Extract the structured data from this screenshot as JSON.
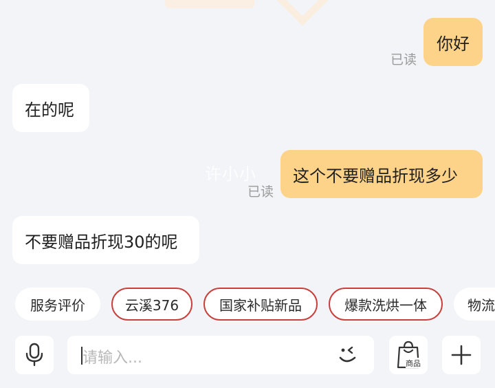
{
  "messages": [
    {
      "from": "me",
      "text": "你好",
      "status": "已读"
    },
    {
      "from": "them",
      "text": "在的呢"
    },
    {
      "from": "me",
      "text": "这个不要赠品折现多少",
      "status": "已读"
    },
    {
      "from": "them",
      "text": "不要赠品折现30的呢"
    }
  ],
  "watermark": "许小小",
  "quick_replies": [
    "服务评价",
    "云溪376",
    "国家补贴新品",
    "爆款洗烘一体",
    "物流"
  ],
  "input": {
    "placeholder": "请输入..."
  },
  "product_button_label": "商品",
  "colors": {
    "my_bubble": "#fdd38a",
    "their_bubble": "#ffffff",
    "background": "#f3f4f8",
    "chip_highlight_border": "#c8403c"
  }
}
